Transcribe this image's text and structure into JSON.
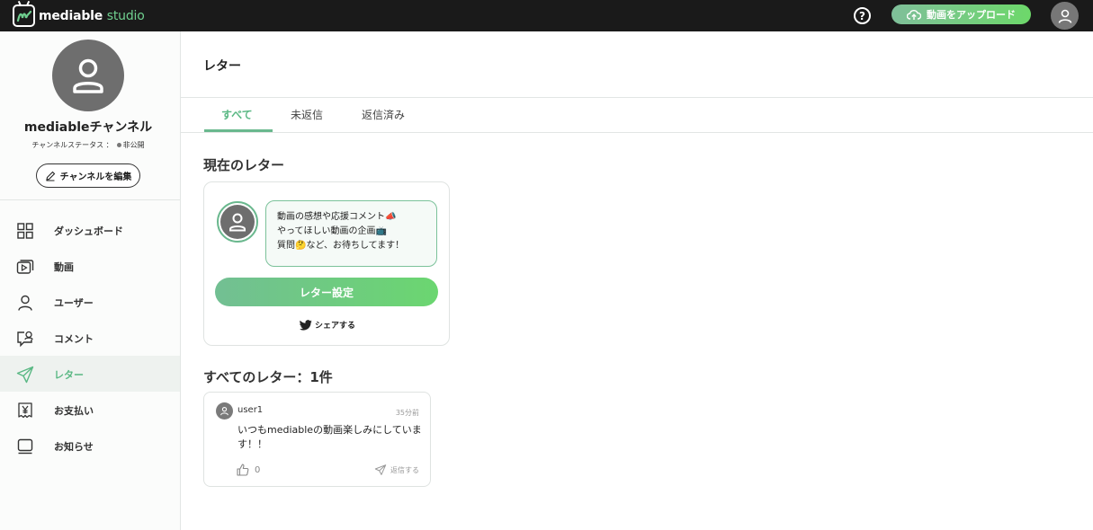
{
  "app": {
    "logo_text": "mediable",
    "logo_suffix": "studio",
    "upload_label": "動画をアップロード",
    "help_label": "?"
  },
  "colors": {
    "accent": "#5ab884",
    "topbar": "#1a1a1a",
    "gradient_start": "#72bf93",
    "gradient_end": "#6bd670"
  },
  "sidebar": {
    "channel_name": "mediableチャンネル",
    "status_label": "チャンネルステータス ：",
    "status_value": "非公開",
    "edit_label": "チャンネルを編集",
    "items": [
      {
        "label": "ダッシュボード",
        "icon": "grid-icon",
        "active": false
      },
      {
        "label": "動画",
        "icon": "video-icon",
        "active": false
      },
      {
        "label": "ユーザー",
        "icon": "user-icon",
        "active": false
      },
      {
        "label": "コメント",
        "icon": "comment-icon",
        "active": false
      },
      {
        "label": "レター",
        "icon": "paper-plane-icon",
        "active": true
      },
      {
        "label": "お支払い",
        "icon": "yen-icon",
        "active": false
      },
      {
        "label": "お知らせ",
        "icon": "notice-icon",
        "active": false
      }
    ]
  },
  "main": {
    "title": "レター",
    "tabs": [
      {
        "label": "すべて",
        "active": true
      },
      {
        "label": "未返信",
        "active": false
      },
      {
        "label": "返信済み",
        "active": false
      }
    ],
    "current_section_title": "現在のレター",
    "letter": {
      "bubble_lines": [
        "動画の感想や応援コメント📣",
        "やってほしい動画の企画📺",
        "質問🤔など、お待ちしてます！"
      ],
      "setting_button": "レター設定",
      "share_label": "シェアする"
    },
    "all_section_title": "すべてのレター：1件",
    "comments": [
      {
        "user": "user1",
        "time": "35分前",
        "body": "いつもmediableの動画楽しみにしています！！",
        "likes": "0",
        "reply_label": "返信する"
      }
    ]
  }
}
